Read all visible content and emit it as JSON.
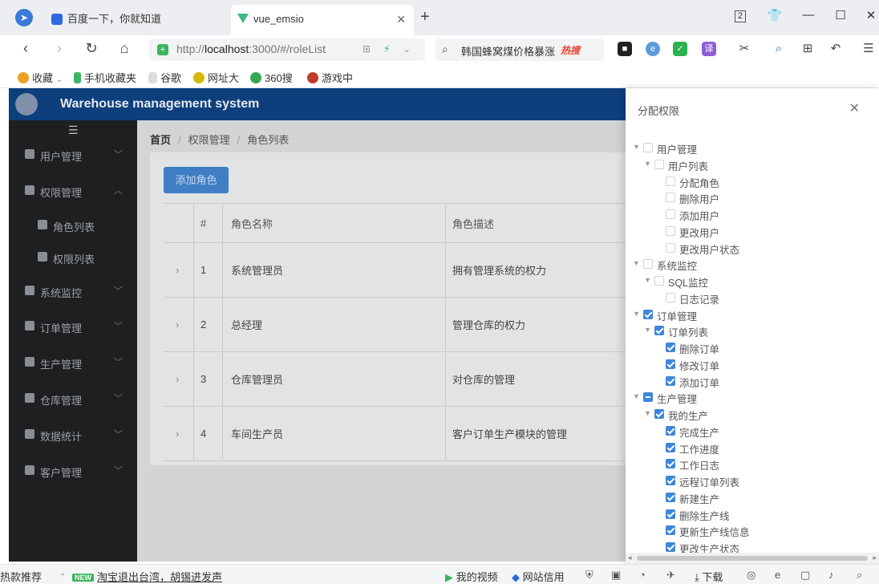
{
  "browser": {
    "tabs": [
      {
        "label": "百度一下，你就知道"
      },
      {
        "label": "vue_emsio"
      }
    ],
    "url_prefix": "http://",
    "url_host": "localhost",
    "url_rest": ":3000/#/roleList",
    "search_text": "韩国蜂窝煤价格暴涨",
    "search_hot": "热搜",
    "tab_counter": "2",
    "bookmarks": [
      "收藏",
      "手机收藏夹",
      "谷歌",
      "网址大",
      "360搜",
      "游戏中"
    ]
  },
  "app": {
    "title": "Warehouse management system",
    "sidebar": [
      {
        "label": "用户管理",
        "sub": false,
        "chevron": "expand"
      },
      {
        "label": "权限管理",
        "sub": false,
        "chevron": "collapse"
      },
      {
        "label": "角色列表",
        "sub": true
      },
      {
        "label": "权限列表",
        "sub": true
      },
      {
        "label": "系统监控",
        "sub": false,
        "chevron": "expand"
      },
      {
        "label": "订单管理",
        "sub": false,
        "chevron": "expand"
      },
      {
        "label": "生产管理",
        "sub": false,
        "chevron": "expand"
      },
      {
        "label": "仓库管理",
        "sub": false,
        "chevron": "expand"
      },
      {
        "label": "数据统计",
        "sub": false,
        "chevron": "expand"
      },
      {
        "label": "客户管理",
        "sub": false,
        "chevron": "expand"
      }
    ],
    "breadcrumb": [
      "首页",
      "权限管理",
      "角色列表"
    ],
    "add_role_label": "添加角色",
    "table": {
      "headers": [
        "#",
        "角色名称",
        "角色描述"
      ],
      "rows": [
        {
          "index": "1",
          "name": "系统管理员",
          "desc": "拥有管理系统的权力"
        },
        {
          "index": "2",
          "name": "总经理",
          "desc": "管理仓库的权力"
        },
        {
          "index": "3",
          "name": "仓库管理员",
          "desc": "对仓库的管理"
        },
        {
          "index": "4",
          "name": "车间生产员",
          "desc": "客户订单生产模块的管理"
        }
      ]
    }
  },
  "drawer": {
    "title": "分配权限",
    "tree": [
      {
        "label": "用户管理",
        "level": 0,
        "state": "unchecked",
        "arrow": true
      },
      {
        "label": "用户列表",
        "level": 1,
        "state": "unchecked",
        "arrow": true
      },
      {
        "label": "分配角色",
        "level": 2,
        "state": "unchecked",
        "arrow": false
      },
      {
        "label": "删除用户",
        "level": 2,
        "state": "unchecked",
        "arrow": false
      },
      {
        "label": "添加用户",
        "level": 2,
        "state": "unchecked",
        "arrow": false
      },
      {
        "label": "更改用户",
        "level": 2,
        "state": "unchecked",
        "arrow": false
      },
      {
        "label": "更改用户状态",
        "level": 2,
        "state": "unchecked",
        "arrow": false
      },
      {
        "label": "系统监控",
        "level": 0,
        "state": "unchecked",
        "arrow": true
      },
      {
        "label": "SQL监控",
        "level": 1,
        "state": "unchecked",
        "arrow": true
      },
      {
        "label": "日志记录",
        "level": 2,
        "state": "unchecked",
        "arrow": false
      },
      {
        "label": "订单管理",
        "level": 0,
        "state": "checked",
        "arrow": true
      },
      {
        "label": "订单列表",
        "level": 1,
        "state": "checked",
        "arrow": true
      },
      {
        "label": "删除订单",
        "level": 2,
        "state": "checked",
        "arrow": false
      },
      {
        "label": "修改订单",
        "level": 2,
        "state": "checked",
        "arrow": false
      },
      {
        "label": "添加订单",
        "level": 2,
        "state": "checked",
        "arrow": false
      },
      {
        "label": "生产管理",
        "level": 0,
        "state": "indeterminate",
        "arrow": true
      },
      {
        "label": "我的生产",
        "level": 1,
        "state": "checked",
        "arrow": true
      },
      {
        "label": "完成生产",
        "level": 2,
        "state": "checked",
        "arrow": false
      },
      {
        "label": "工作进度",
        "level": 2,
        "state": "checked",
        "arrow": false
      },
      {
        "label": "工作日志",
        "level": 2,
        "state": "checked",
        "arrow": false
      },
      {
        "label": "远程订单列表",
        "level": 2,
        "state": "checked",
        "arrow": false
      },
      {
        "label": "新建生产",
        "level": 2,
        "state": "checked",
        "arrow": false
      },
      {
        "label": "删除生产线",
        "level": 2,
        "state": "checked",
        "arrow": false
      },
      {
        "label": "更新生产线信息",
        "level": 2,
        "state": "checked",
        "arrow": false
      },
      {
        "label": "更改生产状态",
        "level": 2,
        "state": "checked",
        "arrow": false
      }
    ]
  },
  "statusbar": {
    "left": "热款推荐",
    "new_badge": "NEW",
    "news": "淘宝退出台湾，胡锡进发声",
    "video": "我的视频",
    "net": "网站信用",
    "download": "下载"
  },
  "colors": {
    "header": "#0d3f7d",
    "sidebar": "#1e1f21",
    "primary": "#3e86d8"
  }
}
